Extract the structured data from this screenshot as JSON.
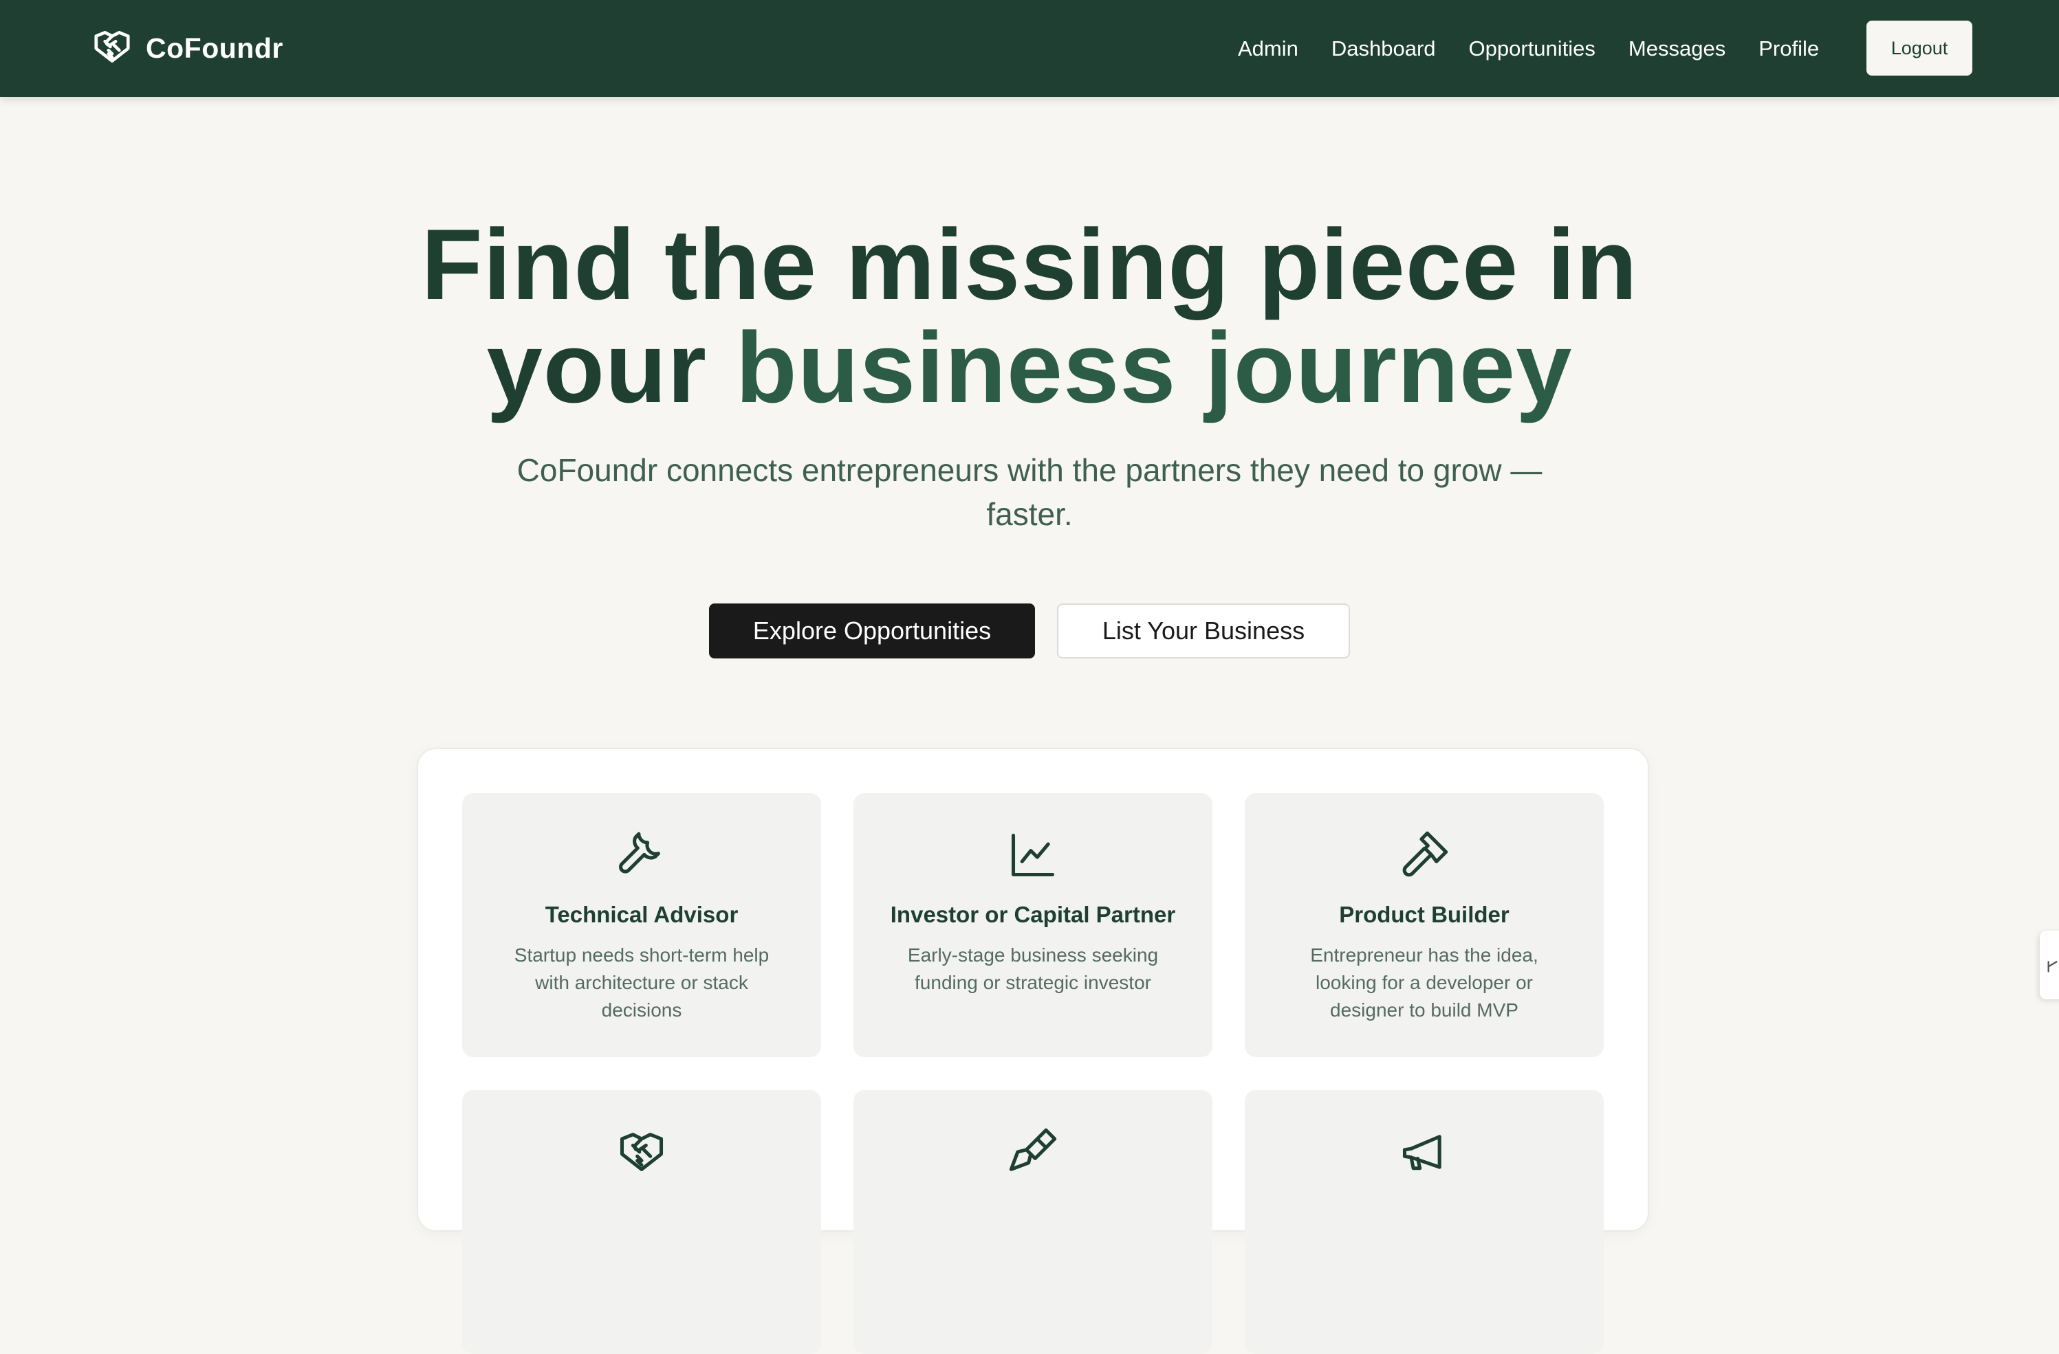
{
  "nav": {
    "brand": "CoFoundr",
    "links": [
      "Admin",
      "Dashboard",
      "Opportunities",
      "Messages",
      "Profile"
    ],
    "logout": "Logout"
  },
  "hero": {
    "title_line1": "Find the missing piece in",
    "title_line2_a": "your",
    "title_line2_b": "business journey",
    "subtitle": "CoFoundr connects entrepreneurs with the partners they need to grow — faster.",
    "primary_cta": "Explore Opportunities",
    "secondary_cta": "List Your Business"
  },
  "cards": [
    {
      "title": "Technical Advisor",
      "desc": "Startup needs short-term help with architecture or stack decisions",
      "icon": "wrench-icon"
    },
    {
      "title": "Investor or Capital Partner",
      "desc": "Early-stage business seeking funding or strategic investor",
      "icon": "chart-line-icon"
    },
    {
      "title": "Product Builder",
      "desc": "Entrepreneur has the idea, looking for a developer or designer to build MVP",
      "icon": "hammer-icon"
    },
    {
      "title": "",
      "desc": "",
      "icon": "handshake-icon"
    },
    {
      "title": "",
      "desc": "",
      "icon": "paintbrush-icon"
    },
    {
      "title": "",
      "desc": "",
      "icon": "megaphone-icon"
    }
  ],
  "colors": {
    "nav_bg": "#1e3f31",
    "page_bg": "#f7f6f2",
    "heading": "#1e3f31",
    "accent": "#2c5c45",
    "card_bg": "#f2f3f0"
  }
}
